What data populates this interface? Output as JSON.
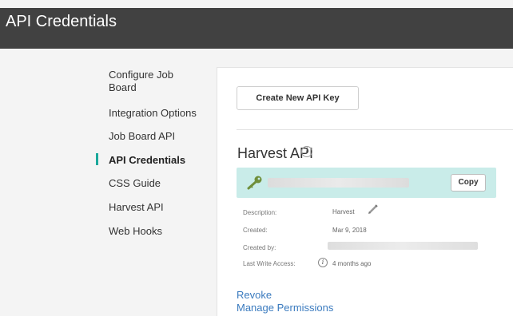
{
  "header": {
    "title": "API Credentials"
  },
  "sidebar": {
    "items": [
      {
        "label": "Configure Job Board",
        "active": false
      },
      {
        "label": "Integration Options",
        "active": false
      },
      {
        "label": "Job Board API",
        "active": false
      },
      {
        "label": "API Credentials",
        "active": true
      },
      {
        "label": "CSS Guide",
        "active": false
      },
      {
        "label": "Harvest API",
        "active": false
      },
      {
        "label": "Web Hooks",
        "active": false
      }
    ]
  },
  "main": {
    "create_button": "Create New API Key",
    "section_title": "Harvest API",
    "key_panel": {
      "copy_label": "Copy"
    },
    "meta": {
      "description_label": "Description:",
      "description_value": "Harvest",
      "created_label": "Created:",
      "created_value": "Mar 9, 2018",
      "created_by_label": "Created by:",
      "last_write_label": "Last Write Access:",
      "last_write_value": "4 months ago"
    },
    "links": {
      "revoke": "Revoke",
      "manage_permissions": "Manage Permissions"
    }
  },
  "colors": {
    "accent": "#1aa89b",
    "header_bg": "#414141",
    "key_panel_bg": "#c9ece9",
    "link": "#3b7bbf"
  },
  "icons": {
    "key": "key-icon",
    "pencil": "pencil-icon",
    "info": "info-icon"
  }
}
